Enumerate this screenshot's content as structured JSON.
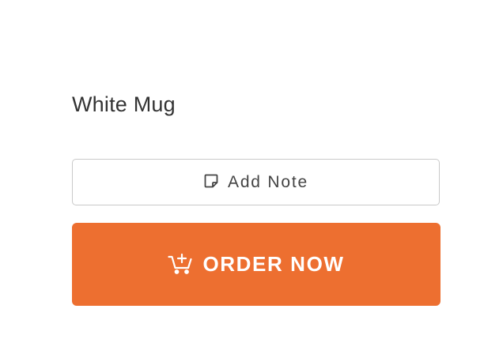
{
  "product": {
    "title": "White Mug"
  },
  "actions": {
    "add_note": {
      "label": "Add Note",
      "icon": "note-icon"
    },
    "order_now": {
      "label": "ORDER NOW",
      "icon": "cart-plus-icon"
    }
  },
  "colors": {
    "title_text": "#333333",
    "note_border": "#c9c9c9",
    "order_button_bg": "#ed6f30",
    "order_button_text": "#ffffff"
  }
}
